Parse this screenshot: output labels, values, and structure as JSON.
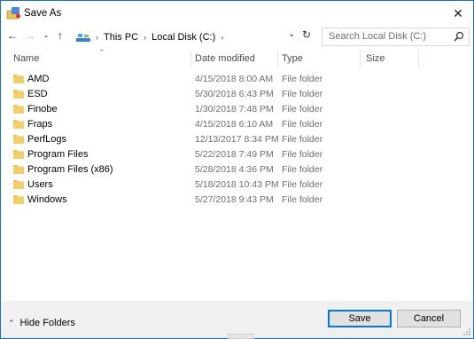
{
  "window": {
    "title": "Save As"
  },
  "nav": {
    "breadcrumbs": [
      "This PC",
      "Local Disk (C:)"
    ],
    "search_placeholder": "Search Local Disk (C:)"
  },
  "columns": {
    "name": "Name",
    "date": "Date modified",
    "type": "Type",
    "size": "Size"
  },
  "files": [
    {
      "name": "AMD",
      "date": "4/15/2018 8:00 AM",
      "type": "File folder"
    },
    {
      "name": "ESD",
      "date": "5/30/2018 6:43 PM",
      "type": "File folder"
    },
    {
      "name": "Finobe",
      "date": "1/30/2018 7:48 PM",
      "type": "File folder"
    },
    {
      "name": "Fraps",
      "date": "4/15/2018 6:10 AM",
      "type": "File folder"
    },
    {
      "name": "PerfLogs",
      "date": "12/13/2017 8:34 PM",
      "type": "File folder"
    },
    {
      "name": "Program Files",
      "date": "5/22/2018 7:49 PM",
      "type": "File folder"
    },
    {
      "name": "Program Files (x86)",
      "date": "5/28/2018 4:36 PM",
      "type": "File folder"
    },
    {
      "name": "Users",
      "date": "5/18/2018 10:43 PM",
      "type": "File folder"
    },
    {
      "name": "Windows",
      "date": "5/27/2018 9:43 PM",
      "type": "File folder"
    }
  ],
  "footer": {
    "hide_folders": "Hide Folders",
    "save": "Save",
    "cancel": "Cancel"
  },
  "colors": {
    "accent": "#0078d7",
    "folder": "#e8c35a",
    "border": "#1e6fc1"
  }
}
